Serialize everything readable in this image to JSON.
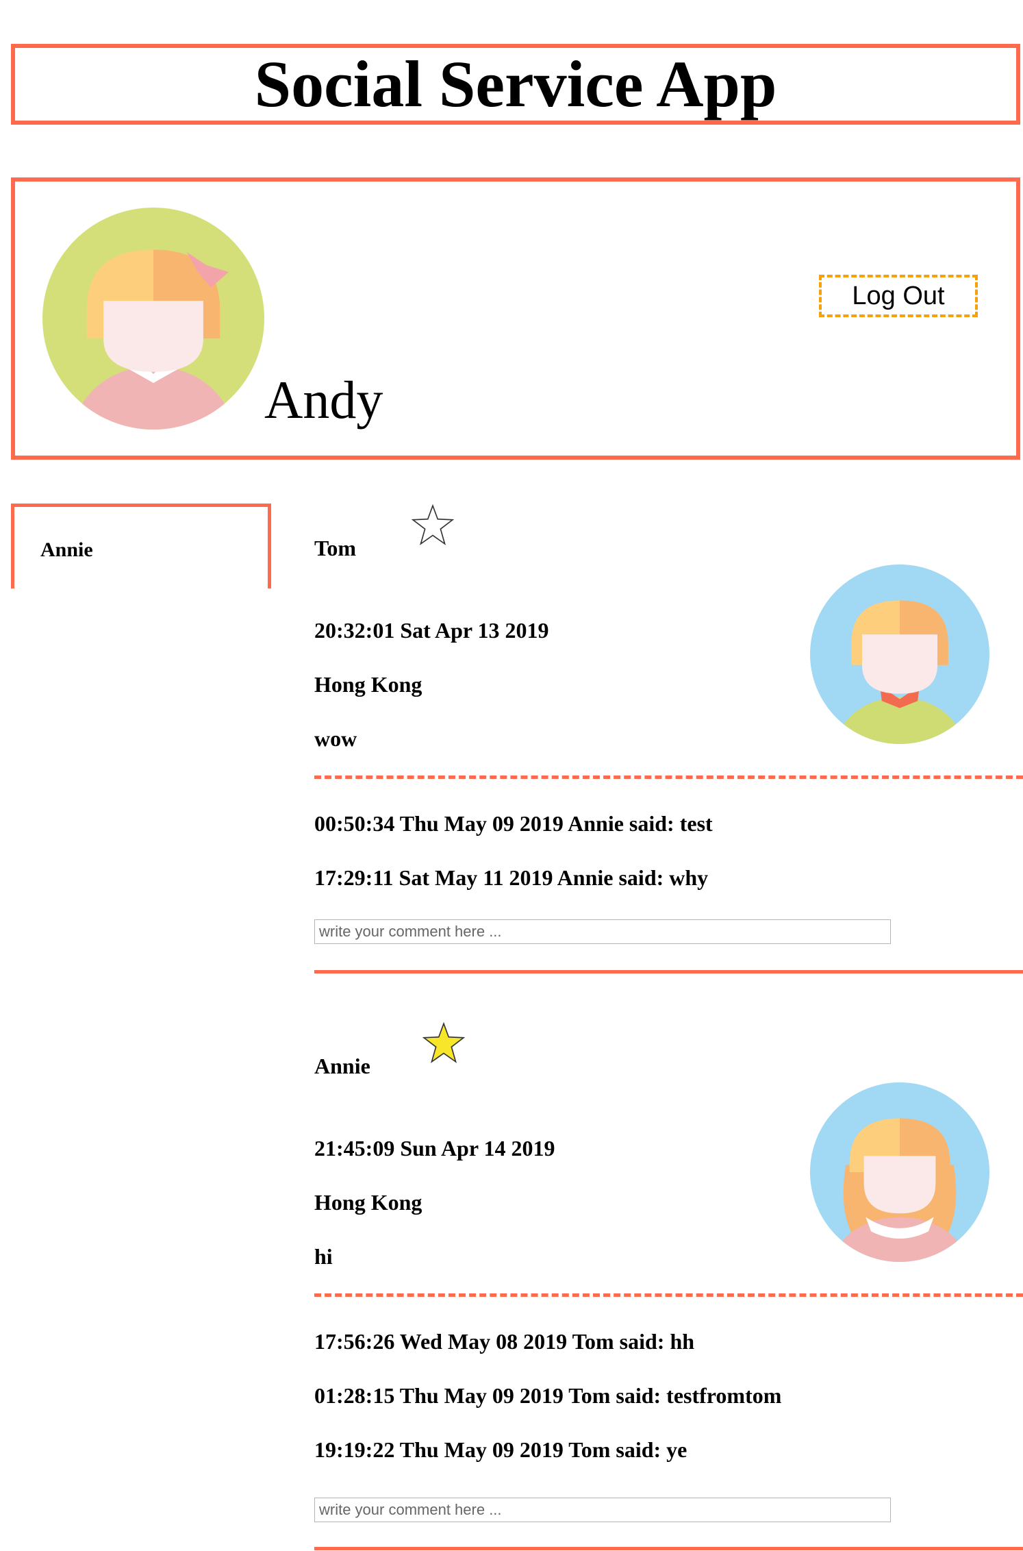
{
  "app": {
    "title": "Social Service App"
  },
  "profile": {
    "name": "Andy",
    "logout_label": "Log Out"
  },
  "sidebar": {
    "items": [
      {
        "label": "Annie"
      }
    ]
  },
  "comment_placeholder": "write your comment here ...",
  "posts": [
    {
      "author": "Tom",
      "starred": false,
      "time": "20:32:01 Sat Apr 13 2019",
      "location": "Hong Kong",
      "text": "wow",
      "comments": [
        "00:50:34 Thu May 09 2019 Annie said: test",
        "17:29:11 Sat May 11 2019 Annie said: why"
      ]
    },
    {
      "author": "Annie",
      "starred": true,
      "time": "21:45:09 Sun Apr 14 2019",
      "location": "Hong Kong",
      "text": "hi",
      "comments": [
        "17:56:26 Wed May 08 2019 Tom said: hh",
        "01:28:15 Thu May 09 2019 Tom said: testfromtom",
        "19:19:22 Thu May 09 2019 Tom said: ye"
      ]
    }
  ],
  "colors": {
    "accent": "#fd6a4e",
    "logout_border": "#f5a10a",
    "star_fill": "#f7e62a",
    "avatar_bg_profile": "#d5df7a",
    "avatar_bg_post": "#a1d8f4"
  }
}
